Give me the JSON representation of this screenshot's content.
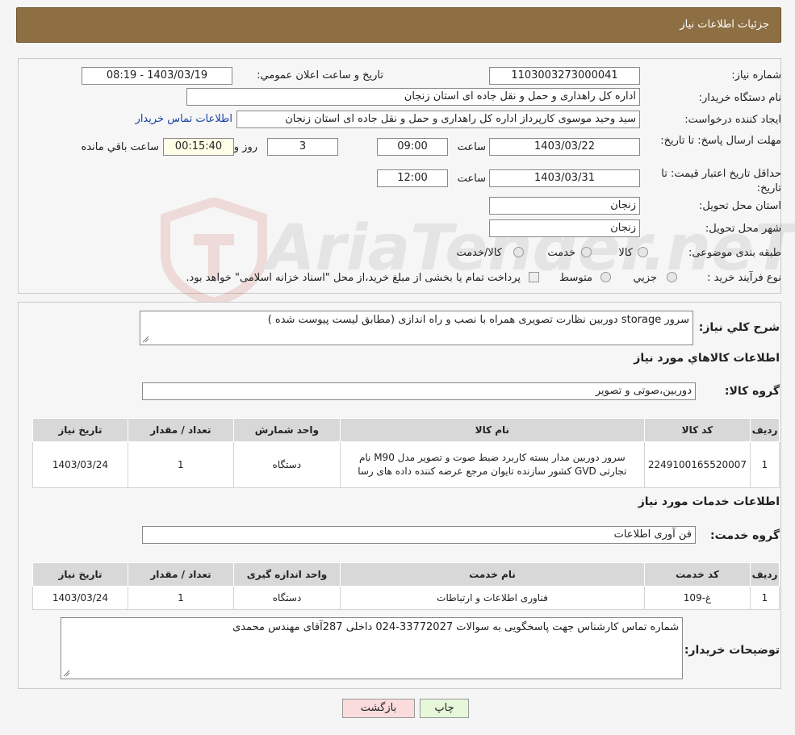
{
  "header": {
    "title": "جزئیات اطلاعات نیاز"
  },
  "form": {
    "need_number_label": "شماره نیاز:",
    "need_number": "1103003273000041",
    "announce_label": "تاریخ و ساعت اعلان عمومي:",
    "announce_value": "1403/03/19 - 08:19",
    "buyer_org_label": "نام دستگاه خريدار:",
    "buyer_org": "اداره کل راهداری و حمل و نقل جاده ای استان زنجان",
    "creator_label": "ايجاد کننده درخواست:",
    "creator": "سید وحید موسوی کارپرداز اداره کل راهداری و حمل و نقل جاده ای استان زنجان",
    "contact_link": "اطلاعات تماس خريدار",
    "reply_deadline_label": "مهلت ارسال پاسخ: تا تاريخ:",
    "reply_date": "1403/03/22",
    "time_label": "ساعت",
    "reply_time": "09:00",
    "days_value": "3",
    "days_label": "روز و",
    "remaining_time": "00:15:40",
    "remaining_label": "ساعت باقي مانده",
    "validity_label": "حداقل تاريخ اعتبار قيمت: تا تاريخ:",
    "validity_date": "1403/03/31",
    "validity_time": "12:00",
    "province_label": "استان محل تحويل:",
    "province": "زنجان",
    "city_label": "شهر محل تحويل:",
    "city": "زنجان",
    "category_label": "طبقه بندی موضوعی:",
    "category_options": [
      "کالا",
      "خدمت",
      "کالا/خدمت"
    ],
    "process_label": "نوع فرآيند خريد :",
    "process_options": [
      "جزيي",
      "متوسط"
    ],
    "process_note": "پرداخت تمام يا بخشی از مبلغ خريد،از محل \"اسناد خزانه اسلامی\" خواهد بود."
  },
  "description": {
    "label": "شرح کلي نياز:",
    "text": "سرور storage دوربین نظارت تصویری همراه با نصب و راه اندازی (مطابق لیست پیوست شده )"
  },
  "goods": {
    "heading": "اطلاعات کالاهاي مورد نياز",
    "group_label": "گروه کالا:",
    "group_value": "دوربین،صوتی و تصویر",
    "columns": [
      "رديف",
      "کد کالا",
      "نام کالا",
      "واحد شمارش",
      "تعداد / مقدار",
      "تاريخ نياز"
    ],
    "rows": [
      [
        "1",
        "2249100165520007",
        "سرور دوربین مدار بسته کاربرد ضبط صوت و تصویر مدل M90 نام تجارتی GVD کشور سازنده تایوان مرجع عرضه کننده داده های رسا",
        "دستگاه",
        "1",
        "1403/03/24"
      ]
    ]
  },
  "services": {
    "heading": "اطلاعات خدمات مورد نياز",
    "group_label": "گروه خدمت:",
    "group_value": "فن آوری اطلاعات",
    "columns": [
      "رديف",
      "کد خدمت",
      "نام خدمت",
      "واحد اندازه گيری",
      "تعداد / مقدار",
      "تاريخ نياز"
    ],
    "rows": [
      [
        "1",
        "غ-109",
        "فناوری اطلاعات و ارتباطات",
        "دستگاه",
        "1",
        "1403/03/24"
      ]
    ]
  },
  "buyer_notes": {
    "label": "توضيحات خريدار:",
    "text": "شماره تماس کارشناس جهت پاسخگویی به سوالات 33772027-024 داخلی 287آقای مهندس محمدی"
  },
  "buttons": {
    "print": "چاپ",
    "back": "بازگشت"
  },
  "watermark": {
    "text": "AriaTender.neT"
  },
  "colors": {
    "header_bg": "#8d6f43",
    "print_btn": "#e7f8da",
    "back_btn": "#fbdcdc",
    "link": "#1a43a6"
  }
}
